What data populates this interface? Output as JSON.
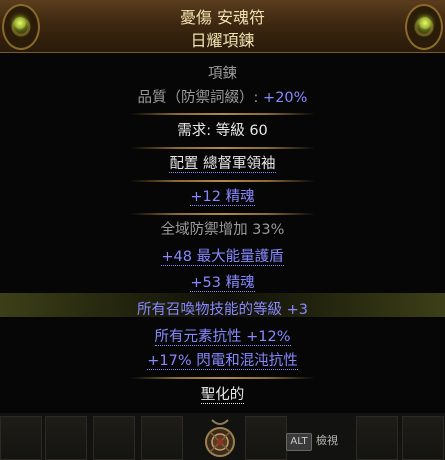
{
  "header": {
    "item_name": "憂傷 安魂符",
    "base_type": "日耀項鍊"
  },
  "tooltip": {
    "item_class": "項鍊",
    "quality_label": "品質（防禦詞綴）: ",
    "quality_value": "+20%",
    "requirement": "需求: 等級 60",
    "implicit": "配置 總督軍領袖",
    "enchant": "+12 精魂",
    "mods": [
      "全域防禦增加 33%",
      "+48 最大能量護盾",
      "+53 精魂",
      "所有召喚物技能的等級 +3",
      "所有元素抗性 +12%",
      "+17% 閃電和混沌抗性"
    ],
    "sanctified": "聖化的"
  },
  "footer": {
    "alt_key": "ALT",
    "inspect_label": "檢視"
  },
  "colors": {
    "magic": "#8888ff",
    "header_text": "#f0e2b0",
    "separator": "#b08a45"
  },
  "icons": [
    "amulet-icon",
    "orb-icon"
  ]
}
